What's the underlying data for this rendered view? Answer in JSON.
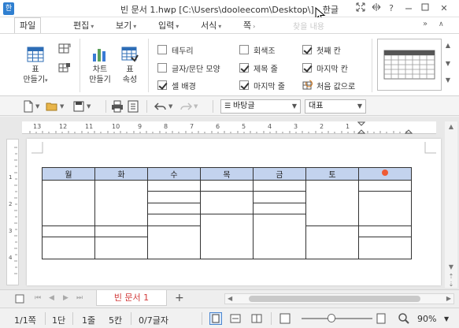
{
  "window": {
    "app_logo": "한",
    "title": "빈 문서 1.hwp [C:\\Users\\dooleecom\\Desktop\\] - 한글",
    "buttons": [
      "expand-icon",
      "resize-icon",
      "help-icon",
      "minimize-icon",
      "close-icon"
    ],
    "help_label": "?",
    "close_label": "✕"
  },
  "menu": {
    "file": "파일",
    "items": [
      "편집",
      "보기",
      "입력",
      "서식",
      "쪽"
    ],
    "ghost": "찾을 내용"
  },
  "ribbon": {
    "table_create": [
      "표",
      "만들기"
    ],
    "chart_create": [
      "차트",
      "만들기"
    ],
    "table_props": [
      "표",
      "속성"
    ],
    "checkboxes": [
      {
        "label": "테두리",
        "checked": false
      },
      {
        "label": "글자/문단 모양",
        "checked": false
      },
      {
        "label": "셀 배경",
        "checked": true
      },
      {
        "label": "회색조",
        "checked": false
      },
      {
        "label": "제목 줄",
        "checked": true
      },
      {
        "label": "마지막 줄",
        "checked": true
      },
      {
        "label": "첫째 칸",
        "checked": true
      },
      {
        "label": "마지막 칸",
        "checked": true
      }
    ],
    "reset_label": "처음 값으로"
  },
  "toolbar": {
    "style_combo": "바탕글",
    "font_combo": "대표"
  },
  "ruler": {
    "numbers": [
      "13",
      "12",
      "11",
      "10",
      "9",
      "8",
      "7",
      "6",
      "5",
      "4",
      "3",
      "2",
      "1"
    ],
    "v_numbers": [
      "1",
      "2",
      "3",
      "4"
    ]
  },
  "table": {
    "headers": [
      "월",
      "화",
      "수",
      "목",
      "금",
      "토",
      ""
    ],
    "accent": "#c3d3ee",
    "dot_color": "#ef5b35"
  },
  "tabs": {
    "doc_tab": "빈 문서 1",
    "add": "+"
  },
  "status": {
    "page": "1/1쪽",
    "section": "1단",
    "line": "1줄",
    "column": "5칸",
    "chars": "0/7글자",
    "zoom": "90%",
    "zoom_level_percent": 90
  }
}
